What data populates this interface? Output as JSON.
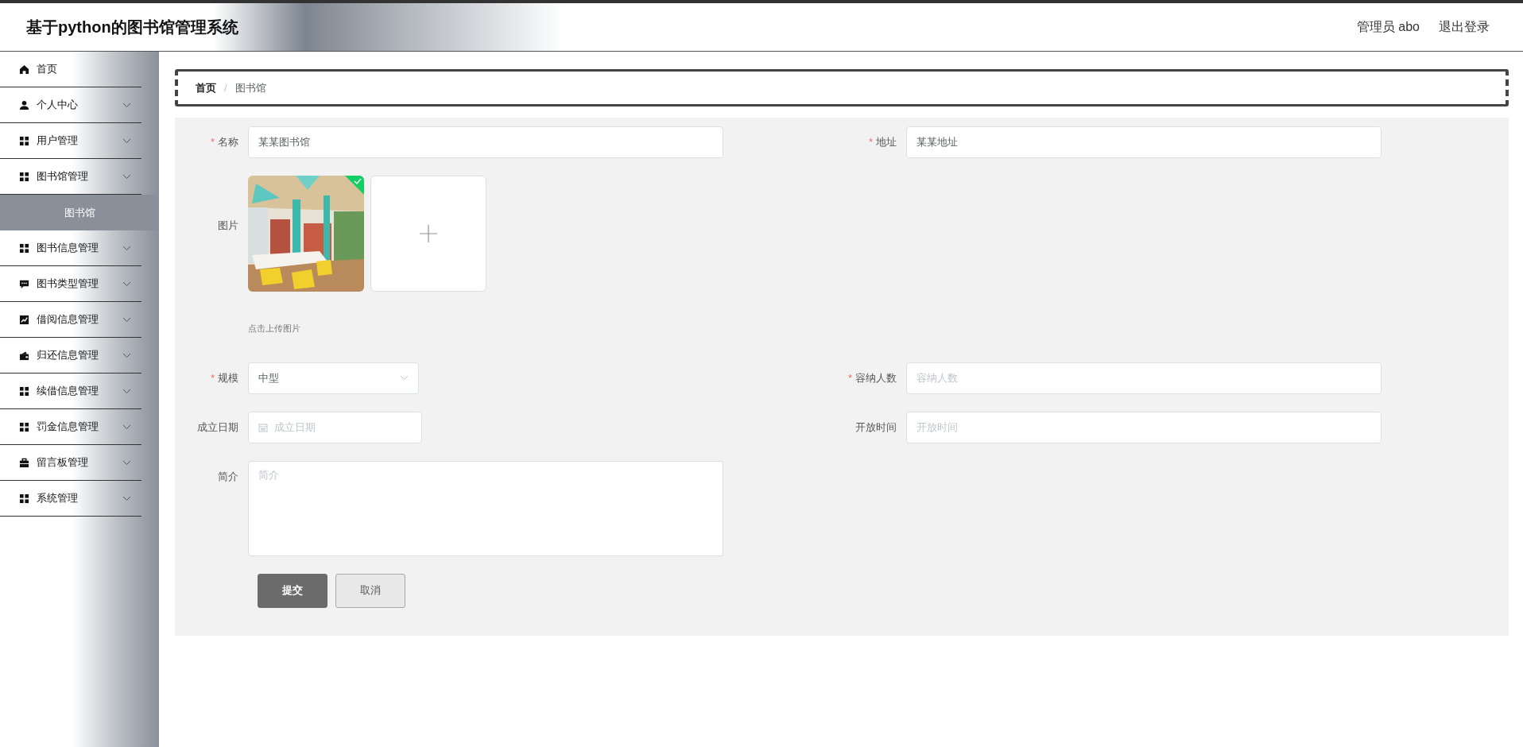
{
  "header": {
    "title": "基于python的图书馆管理系统",
    "user": "管理员 abo",
    "logout": "退出登录"
  },
  "sidebar": {
    "items": [
      {
        "kind": "home",
        "label": "首页",
        "has_submenu": false,
        "selected": false
      },
      {
        "kind": "user",
        "label": "个人中心",
        "has_submenu": true,
        "selected": false
      },
      {
        "kind": "grid",
        "label": "用户管理",
        "has_submenu": true,
        "selected": false
      },
      {
        "kind": "grid",
        "label": "图书馆管理",
        "has_submenu": true,
        "selected": false,
        "children": [
          {
            "label": "图书馆",
            "selected": true
          }
        ]
      },
      {
        "kind": "grid",
        "label": "图书信息管理",
        "has_submenu": true,
        "selected": false
      },
      {
        "kind": "chat",
        "label": "图书类型管理",
        "has_submenu": true,
        "selected": false
      },
      {
        "kind": "chart",
        "label": "借阅信息管理",
        "has_submenu": true,
        "selected": false
      },
      {
        "kind": "wallet",
        "label": "归还信息管理",
        "has_submenu": true,
        "selected": false
      },
      {
        "kind": "grid",
        "label": "续借信息管理",
        "has_submenu": true,
        "selected": false
      },
      {
        "kind": "grid",
        "label": "罚金信息管理",
        "has_submenu": true,
        "selected": false
      },
      {
        "kind": "briefcase",
        "label": "留言板管理",
        "has_submenu": true,
        "selected": false
      },
      {
        "kind": "grid",
        "label": "系统管理",
        "has_submenu": true,
        "selected": false
      }
    ]
  },
  "breadcrumb": {
    "separator": "/",
    "items": [
      {
        "label": "首页",
        "current": false
      },
      {
        "label": "图书馆",
        "current": true
      }
    ]
  },
  "form": {
    "rows": [
      {
        "fields": [
          {
            "kind": "text",
            "label": "名称",
            "required_mark": "*",
            "value": "某某图书馆"
          },
          {
            "kind": "text",
            "label": "地址",
            "required_mark": "*",
            "value": "某某地址"
          }
        ]
      },
      {
        "fields": [
          {
            "kind": "upload",
            "label": "图片",
            "images": [
              {
                "kind": "picture",
                "success": true
              }
            ],
            "hint": "点击上传图片"
          }
        ]
      },
      {
        "fields": [
          {
            "kind": "select",
            "label": "规模",
            "required_mark": "*",
            "value": "中型"
          },
          {
            "kind": "text",
            "label": "容纳人数",
            "required_mark": "*",
            "placeholder": "容纳人数"
          }
        ]
      },
      {
        "fields": [
          {
            "kind": "date",
            "label": "成立日期",
            "placeholder": "成立日期"
          },
          {
            "kind": "text",
            "label": "开放时间",
            "placeholder": "开放时间"
          }
        ]
      },
      {
        "fields": [
          {
            "kind": "textarea",
            "label": "简介",
            "placeholder": "简介"
          }
        ]
      }
    ],
    "buttons": [
      {
        "label": "提交",
        "kind": "primary"
      },
      {
        "label": "取消",
        "kind": "default"
      }
    ]
  }
}
